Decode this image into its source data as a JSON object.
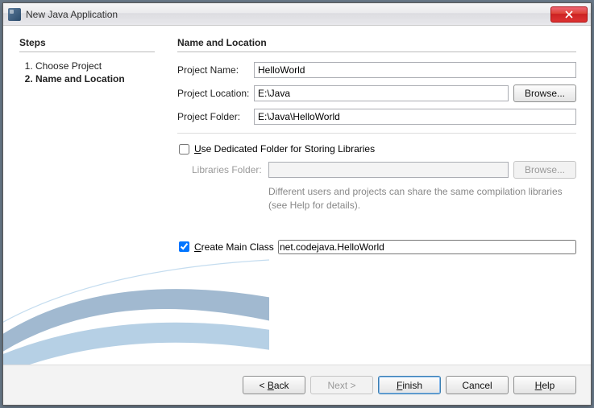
{
  "window": {
    "title": "New Java Application"
  },
  "sidebar": {
    "heading": "Steps",
    "items": [
      {
        "label": "Choose Project",
        "current": false
      },
      {
        "label": "Name and Location",
        "current": true
      }
    ]
  },
  "main": {
    "heading": "Name and Location",
    "project_name_label": "Project Name:",
    "project_name_value": "HelloWorld",
    "project_location_label": "Project Location:",
    "project_location_value": "E:\\Java",
    "browse_label": "Browse...",
    "project_folder_label": "Project Folder:",
    "project_folder_value": "E:\\Java\\HelloWorld",
    "dedicated_checked": false,
    "dedicated_label": "Use Dedicated Folder for Storing Libraries",
    "libraries_label": "Libraries Folder:",
    "libraries_value": "",
    "libraries_browse_label": "Browse...",
    "libraries_help": "Different users and projects can share the same compilation libraries (see Help for details).",
    "create_main_checked": true,
    "create_main_label": "Create Main Class",
    "create_main_value": "net.codejava.HelloWorld"
  },
  "footer": {
    "back": "< Back",
    "next": "Next >",
    "finish": "Finish",
    "cancel": "Cancel",
    "help": "Help"
  }
}
